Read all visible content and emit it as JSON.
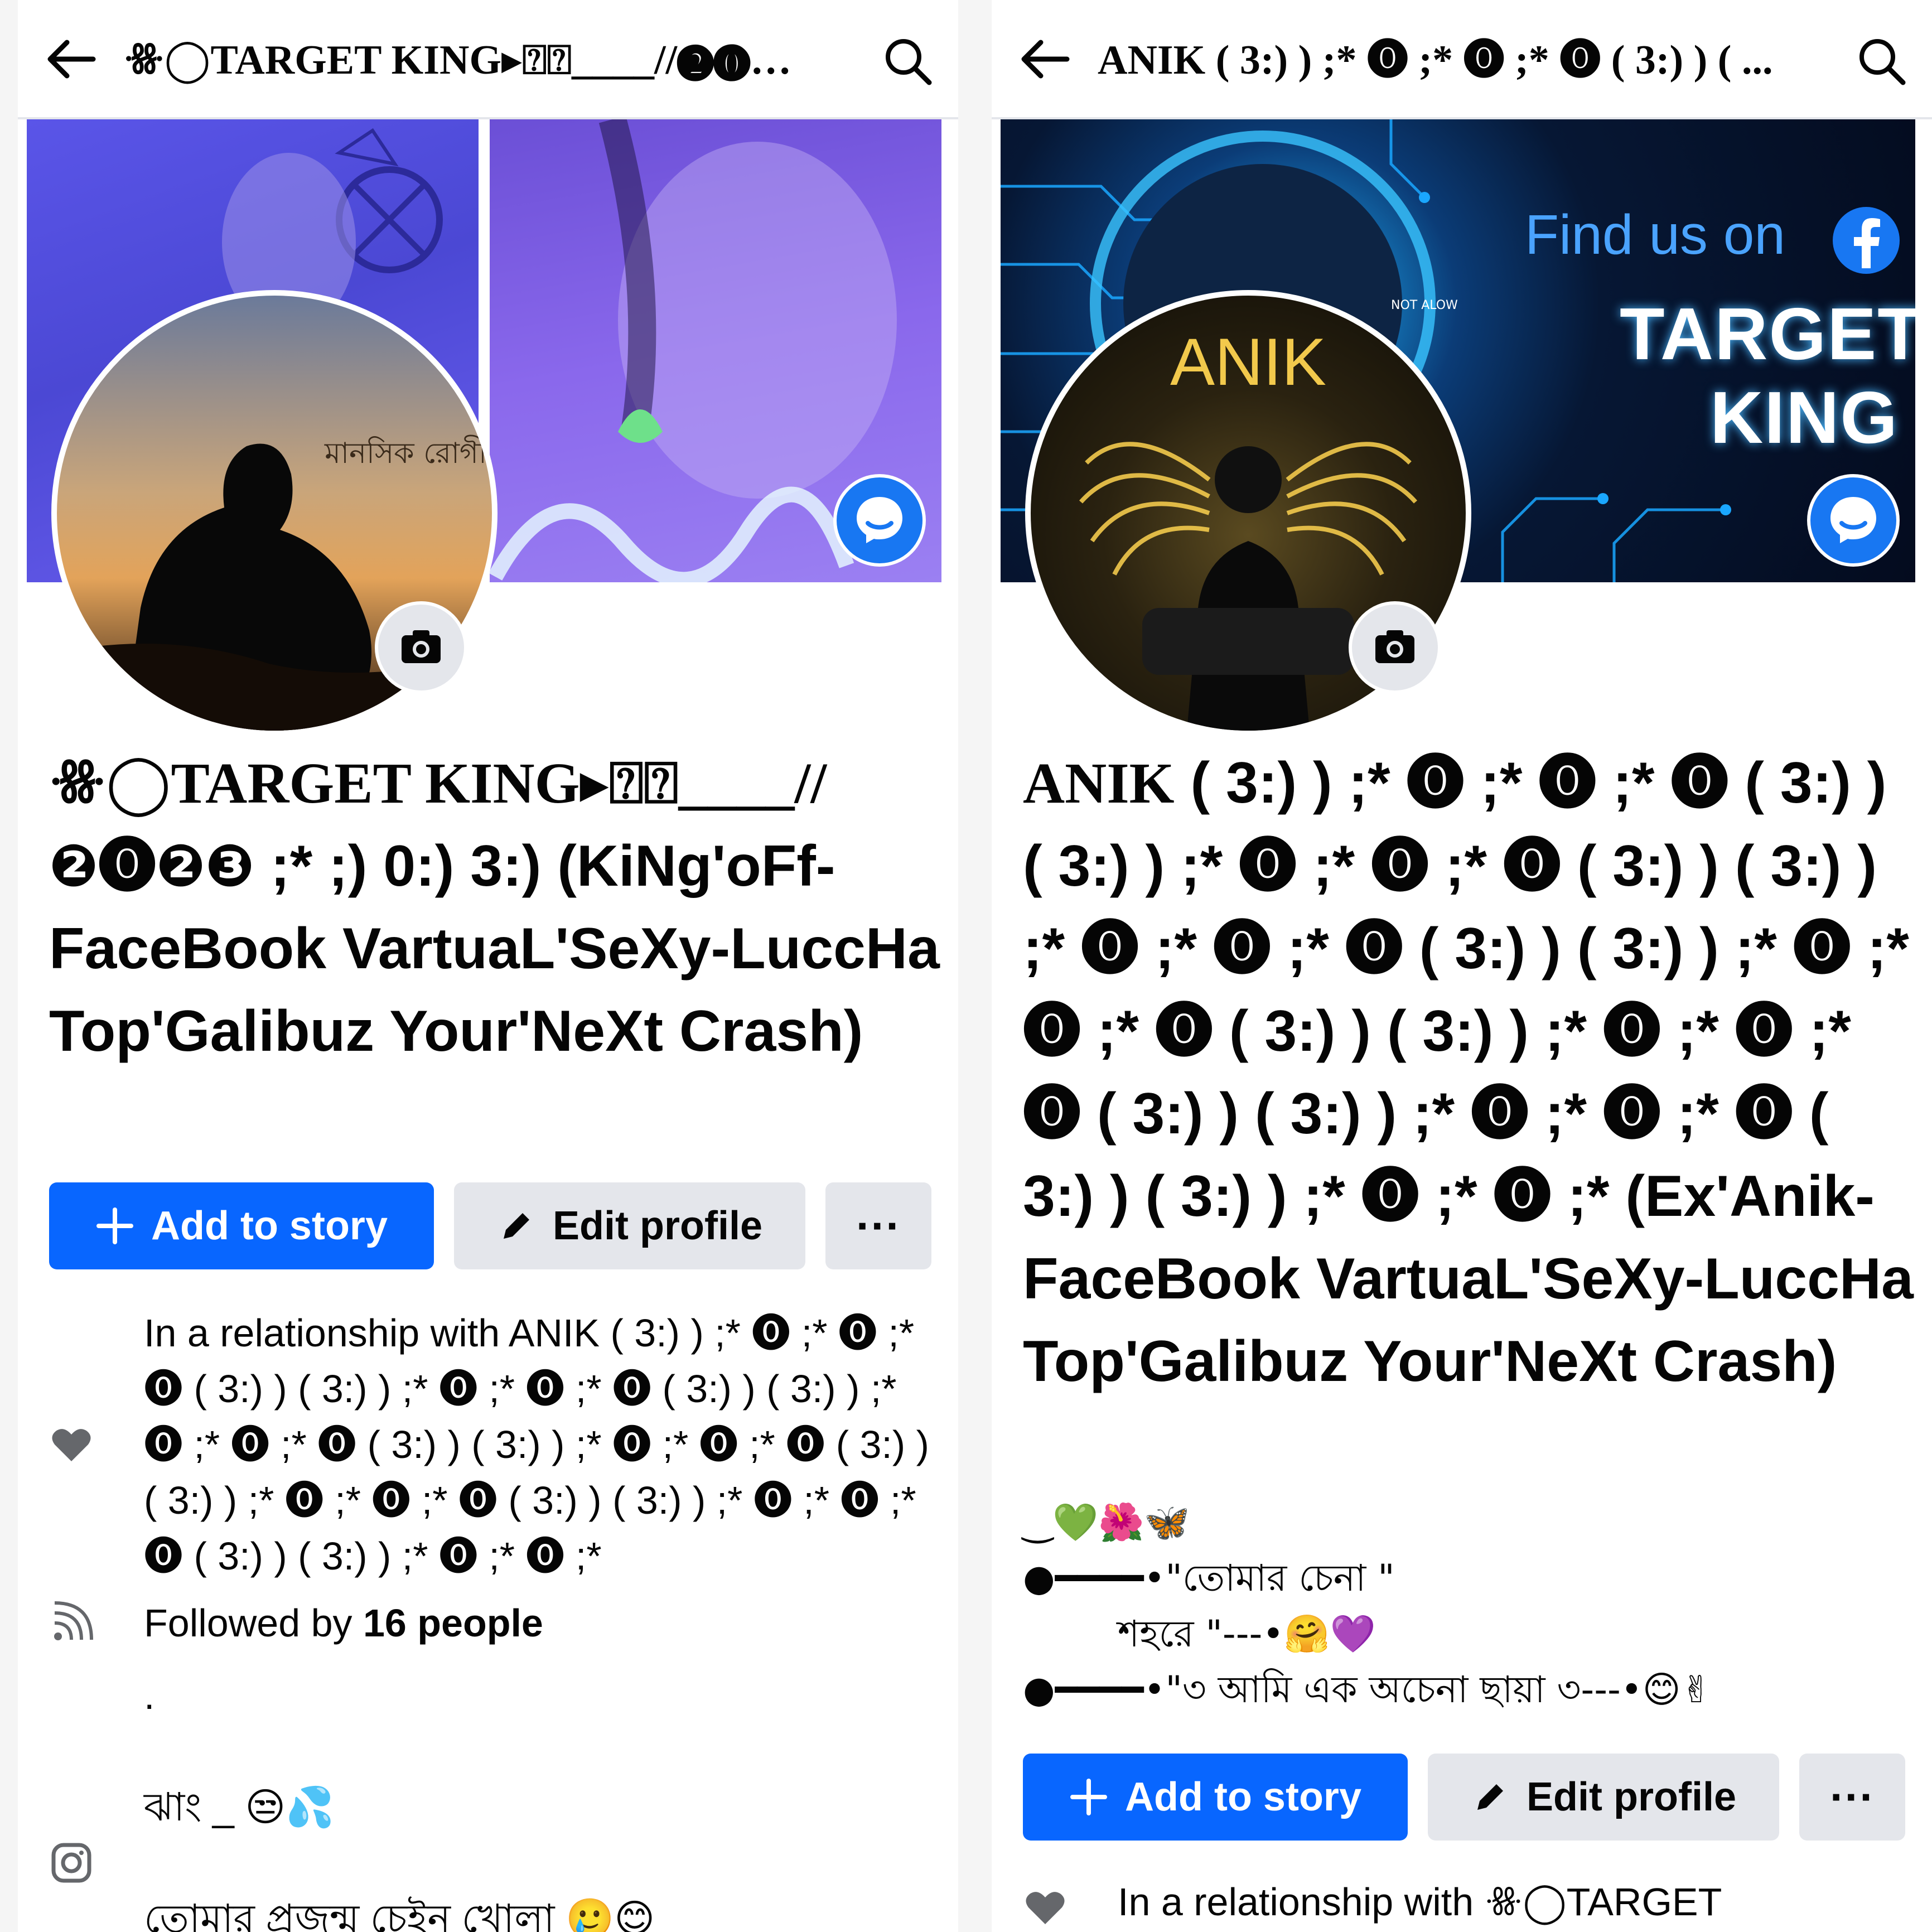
{
  "left": {
    "header_title": "ꗥ◯TARGET KING▸⍰⍰____//❷⓿❷...",
    "profile_name_serif": "ꗥ◯TARGET KING▸⍰⍰____//",
    "profile_name_rest": "❷⓿❷❸ ;* ;) 0:) 3:)   (KiNg'oFf-FaceBook VartuaL'SeXy-LuccHa Top'Galibuz Your'NeXt Crash)",
    "add_story": "Add to story",
    "edit_profile": "Edit profile",
    "more": "···",
    "relationship": "In a relationship with ANIK   ( 3:) ) ;* ⓿ ;* ⓿ ;* ⓿ ( 3:) ) ( 3:) ) ;* ⓿ ;* ⓿ ;* ⓿ ( 3:) ) ( 3:) ) ;* ⓿ ;* ⓿ ;* ⓿ ( 3:) ) ( 3:) ) ;* ⓿ ;* ⓿ ;* ⓿ ( 3:) ) ( 3:) ) ;* ⓿ ;* ⓿ ;* ⓿ ( 3:) ) ( 3:) ) ;* ⓿ ;* ⓿ ;* ⓿ ( 3:) ) ( 3:) ) ;* ⓿ ;* ⓿ ;*",
    "followed_prefix": "Followed by",
    "followed_count": "16 people",
    "dot": ".",
    "bio_line1": "ঝাং _ 😒💦",
    "bio_line2": "তোমার প্রজন্ম চেইন খোলা 🥲😊",
    "avatar_caption": "মানসিক রোগী"
  },
  "right": {
    "header_title": "ANIK   ( 3:) ) ;* ⓿ ;* ⓿ ;* ⓿ ( 3:) ) ( ...",
    "profile_name_serif": "ANIK",
    "profile_name_rest": "   ( 3:) ) ;* ⓿ ;* ⓿ ;* ⓿ ( 3:) ) ( 3:) ) ;* ⓿ ;* ⓿ ;* ⓿ ( 3:) ) ( 3:) ) ;* ⓿ ;* ⓿ ;* ⓿ ( 3:) ) ( 3:) ) ;* ⓿ ;* ⓿ ;* ⓿ ( 3:) ) ( 3:) ) ;* ⓿ ;* ⓿ ;* ⓿ ( 3:) ) ( 3:) ) ;* ⓿ ;* ⓿ ;* ⓿ ( 3:) ) ( 3:) ) ;* ⓿ ;* ⓿ ;* (Ex'Anik-FaceBook VartuaL'SeXy-LuccHa Top'Galibuz Your'NeXt Crash)",
    "bio_line1": "‿💚🌺🦋",
    "bio_line2": "●━━━━•\"তোমার চেনা \"",
    "bio_line3": "শহরে \"---•🤗💜",
    "bio_line4": "●━━━━•\"৩ আমি এক অচেনা ছায়া ৩---•😊✌",
    "add_story": "Add to story",
    "edit_profile": "Edit profile",
    "more": "···",
    "relationship": "In a relationship with ꗥ◯TARGET",
    "cover_find_us": "Find us on",
    "cover_name_line1": "TARGET",
    "cover_name_line2": "KING",
    "avatar_word": "ANIK",
    "cover_small_text": "NOT ALOW"
  },
  "colors": {
    "primary_blue": "#0866ff",
    "secondary_gray": "#e4e6eb",
    "messenger_blue": "#1877f2",
    "text": "#050505"
  },
  "icons": [
    "back-arrow-icon",
    "search-icon",
    "camera-icon",
    "messenger-icon",
    "plus-icon",
    "pencil-icon",
    "heart-icon",
    "rss-icon",
    "instagram-icon",
    "facebook-icon"
  ]
}
